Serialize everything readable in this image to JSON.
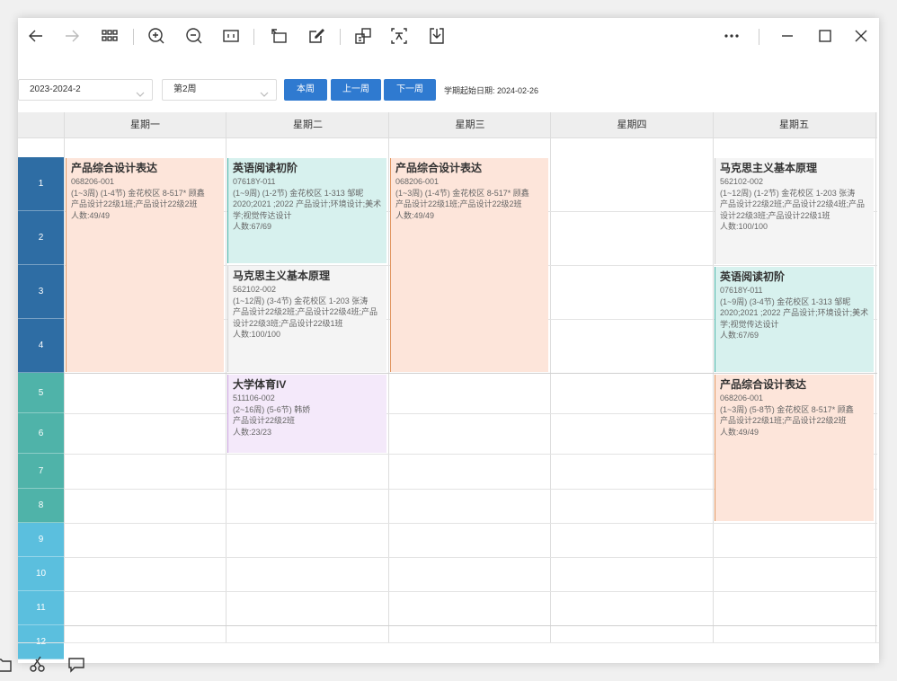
{
  "toolbar": {
    "icons": [
      "back-arrow-icon",
      "forward-arrow-icon",
      "grid-icon",
      "zoom-in-icon",
      "zoom-out-icon",
      "actual-size-icon",
      "rotate-icon",
      "edit-icon",
      "extract-text-icon",
      "translate-icon",
      "download-icon",
      "more-icon",
      "minimize-icon",
      "maximize-icon",
      "close-icon"
    ]
  },
  "controls": {
    "term": "2023-2024-2",
    "week": "第2周",
    "btn_this_week": "本周",
    "btn_prev_week": "上一周",
    "btn_next_week": "下一周",
    "start_date": "学期起始日期:  2024-02-26"
  },
  "days": [
    "星期一",
    "星期二",
    "星期三",
    "星期四",
    "星期五"
  ],
  "periods": [
    "1",
    "2",
    "3",
    "4",
    "5",
    "6",
    "7",
    "8",
    "9",
    "10",
    "11",
    "12"
  ],
  "courses": {
    "mon_1": {
      "name": "产品综合设计表达",
      "code": "068206-001",
      "detail": "(1~3周) (1-4节) 金花校区 8-517*  顾鑫",
      "classes": "产品设计22级1班;产品设计22级2班",
      "count": "人数:49/49"
    },
    "tue_1": {
      "name": "英语阅读初阶",
      "code": "07618Y-011",
      "detail": "(1~9周) (1-2节) 金花校区 1-313  邹昵",
      "classes": "2020;2021 ;2022 产品设计;环境设计;美术学;视觉传达设计",
      "count": "人数:67/69"
    },
    "tue_3": {
      "name": "马克思主义基本原理",
      "code": "562102-002",
      "detail": "(1~12周) (3-4节) 金花校区 1-203  张涛",
      "classes": "产品设计22级2班;产品设计22级4班;产品设计22级3班;产品设计22级1班",
      "count": "人数:100/100"
    },
    "tue_5": {
      "name": "大学体育IV",
      "code": "511106-002",
      "detail": "(2~16周) (5-6节)  韩娇",
      "classes": "产品设计22级2班",
      "count": "人数:23/23"
    },
    "wed_1": {
      "name": "产品综合设计表达",
      "code": "068206-001",
      "detail": "(1~3周) (1-4节) 金花校区 8-517*  顾鑫",
      "classes": "产品设计22级1班;产品设计22级2班",
      "count": "人数:49/49"
    },
    "fri_1": {
      "name": "马克思主义基本原理",
      "code": "562102-002",
      "detail": "(1~12周) (1-2节) 金花校区 1-203  张涛",
      "classes": "产品设计22级2班;产品设计22级4班;产品设计22级3班;产品设计22级1班",
      "count": "人数:100/100"
    },
    "fri_3": {
      "name": "英语阅读初阶",
      "code": "07618Y-011",
      "detail": "(1~9周) (3-4节) 金花校区 1-313  邹昵",
      "classes": "2020;2021 ;2022 产品设计;环境设计;美术学;视觉传达设计",
      "count": "人数:67/69"
    },
    "fri_5": {
      "name": "产品综合设计表达",
      "code": "068206-001",
      "detail": "(1~3周) (5-8节) 金花校区 8-517*  顾鑫",
      "classes": "产品设计22级1班;产品设计22级2班",
      "count": "人数:49/49"
    }
  },
  "colors": {
    "accent_button": "#2f7ad0",
    "period_dark": "#2e6da4",
    "period_teal": "#4fb3a9",
    "period_light": "#5bbfde",
    "course_peach": "#fde5da",
    "course_mint": "#d7f1ee",
    "course_grey": "#f4f4f4",
    "course_lavender": "#f4e9fa"
  }
}
